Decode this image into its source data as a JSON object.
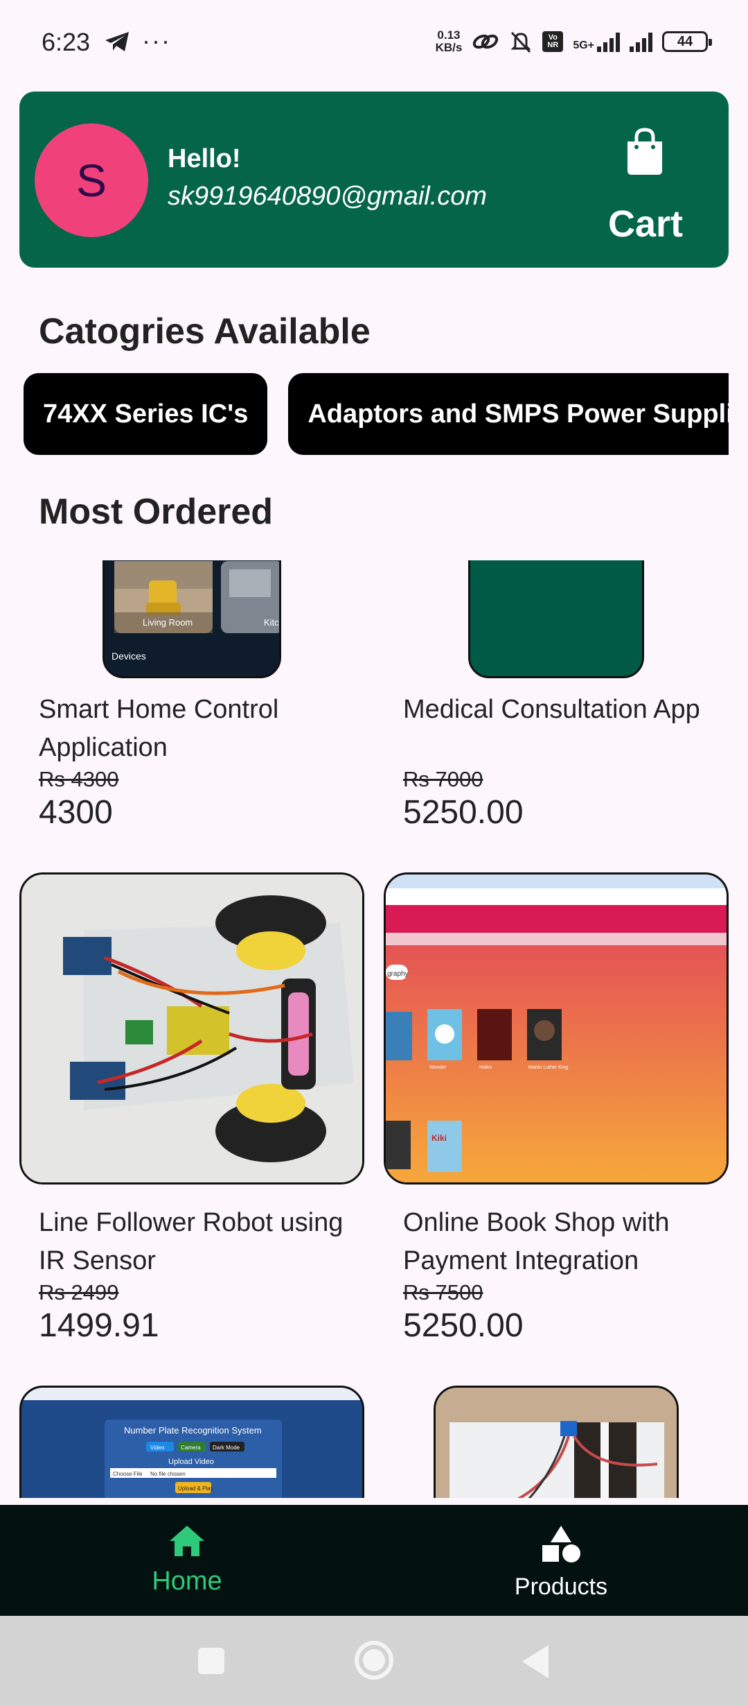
{
  "status_bar": {
    "time": "6:23",
    "dots": "···",
    "net_speed_value": "0.13",
    "net_speed_unit": "KB/s",
    "vo_badge": "Vo NR",
    "network_type": "5G+",
    "battery": "44"
  },
  "header": {
    "avatar_letter": "S",
    "greeting": "Hello!",
    "email": "sk9919640890@gmail.com",
    "cart_label": "Cart"
  },
  "categories": {
    "title": "Catogries Available",
    "items": [
      "74XX Series IC's",
      "Adaptors and SMPS Power Supplie"
    ]
  },
  "most_ordered": {
    "title": "Most Ordered",
    "products": [
      {
        "name": "Smart Home Control Application",
        "old_price": "Rs 4300",
        "price": "4300"
      },
      {
        "name": "Medical Consultation App",
        "old_price": "Rs 7000",
        "price": "5250.00"
      },
      {
        "name": "Line Follower Robot using IR Sensor",
        "old_price": "Rs 2499",
        "price": "1499.91"
      },
      {
        "name": "Online Book Shop with Payment Integration",
        "old_price": "Rs 7500",
        "price": "5250.00"
      }
    ],
    "thumb_texts": {
      "smart_home_room1": "Living Room",
      "smart_home_room2": "Kitc",
      "smart_home_devices": "Devices",
      "bookshop_tag": "graphy",
      "bookshop_books": [
        "Wonder",
        "Holes",
        "Martin Luther King",
        "Kiki"
      ],
      "plate_title": "Number Plate Recognition System",
      "plate_upload": "Upload Video",
      "plate_choose": "Choose File",
      "plate_nofile": "No file chosen",
      "plate_button": "Upload & Play",
      "plate_tab1": "Video",
      "plate_tab2": "Camera",
      "plate_tab3": "Dark Mode"
    }
  },
  "bottom_nav": {
    "home_label": "Home",
    "products_label": "Products",
    "active_color": "#2ec97a"
  },
  "colors": {
    "header_bg": "#056548",
    "avatar_bg": "#f0417a",
    "chip_bg": "#000000",
    "nav_bg": "#031210"
  }
}
